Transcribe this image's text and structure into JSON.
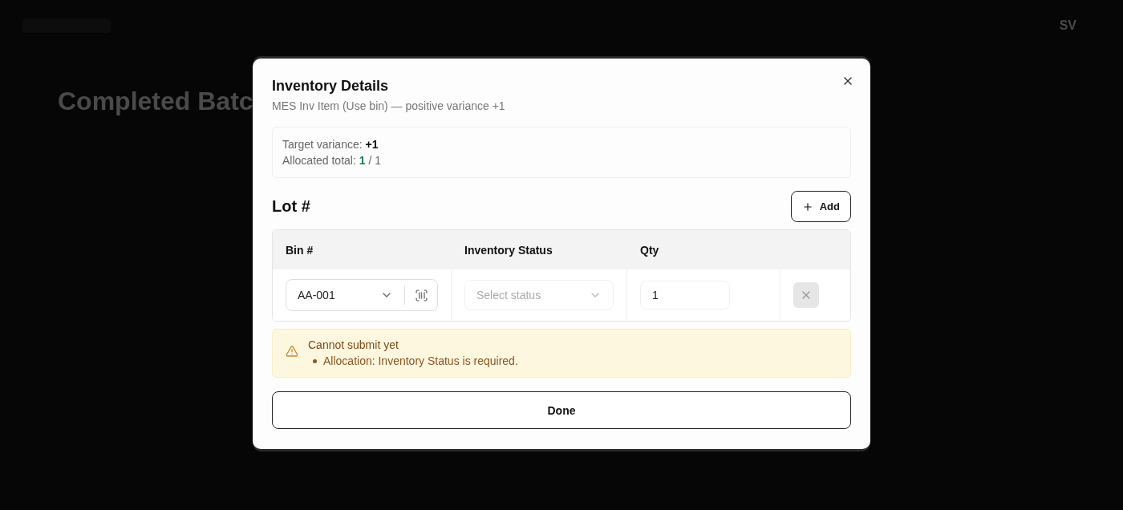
{
  "background": {
    "page_title": "Completed Batc",
    "avatar": "SV"
  },
  "dialog": {
    "title": "Inventory Details",
    "subtitle": "MES Inv Item (Use bin) — positive variance +1",
    "summary": {
      "target_label": "Target variance:",
      "target_value": "+1",
      "allocated_label": "Allocated total:",
      "allocated_value": "1",
      "allocated_of": "/ 1"
    },
    "section_title": "Lot #",
    "add_button": "Add",
    "table": {
      "columns": [
        "Bin #",
        "Inventory Status",
        "Qty"
      ],
      "rows": [
        {
          "bin": "AA-001",
          "status_placeholder": "Select status",
          "qty": "1",
          "remove_disabled": true
        }
      ]
    },
    "warning": {
      "title": "Cannot submit yet",
      "items": [
        "Allocation: Inventory Status is required."
      ]
    },
    "done_button": "Done"
  }
}
